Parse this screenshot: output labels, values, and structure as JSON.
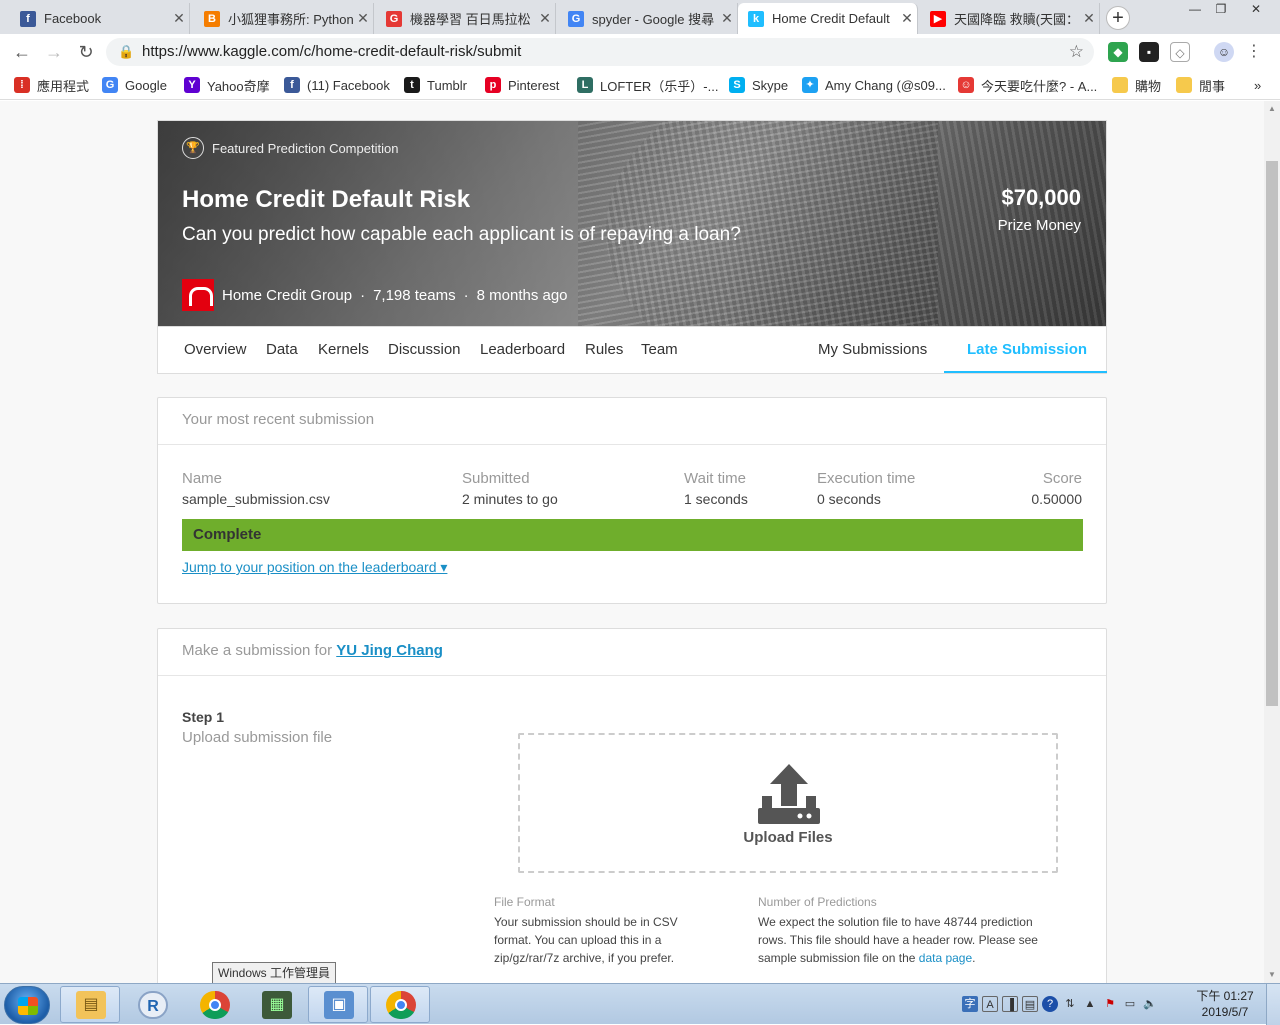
{
  "browser": {
    "tabs": [
      {
        "title": "Facebook",
        "icon": "facebook-icon",
        "color": "#3b5998",
        "glyph": "f"
      },
      {
        "title": "小狐狸事務所: Python",
        "icon": "blogger-icon",
        "color": "#f57d00",
        "glyph": "B"
      },
      {
        "title": "機器學習 百日馬拉松",
        "icon": "cupoy-icon",
        "color": "#e53935",
        "glyph": "G"
      },
      {
        "title": "spyder - Google 搜尋",
        "icon": "google-icon",
        "color": "#4285f4",
        "glyph": "G"
      },
      {
        "title": "Home Credit Default",
        "icon": "kaggle-icon",
        "color": "#20beff",
        "glyph": "k"
      },
      {
        "title": "天國降臨 救贖(天國：",
        "icon": "youtube-icon",
        "color": "#ff0000",
        "glyph": "▶"
      }
    ],
    "active_tab_index": 4,
    "url": "https://www.kaggle.com/c/home-credit-default-risk/submit",
    "bookmarks": [
      {
        "label": "應用程式",
        "icon": "apps-grid-icon",
        "color": "#d93025",
        "glyph": "⁞"
      },
      {
        "label": "Google",
        "icon": "google-icon",
        "color": "#4285f4",
        "glyph": "G"
      },
      {
        "label": "Yahoo奇摩",
        "icon": "yahoo-icon",
        "color": "#5f01d1",
        "glyph": "Y"
      },
      {
        "label": "(11) Facebook",
        "icon": "facebook-icon",
        "color": "#3b5998",
        "glyph": "f"
      },
      {
        "label": "Tumblr",
        "icon": "tumblr-icon",
        "color": "#1a1a1a",
        "glyph": "t"
      },
      {
        "label": "Pinterest",
        "icon": "pinterest-icon",
        "color": "#e60023",
        "glyph": "p"
      },
      {
        "label": "LOFTER（乐乎）-...",
        "icon": "lofter-icon",
        "color": "#2f6e63",
        "glyph": "L"
      },
      {
        "label": "Skype",
        "icon": "skype-icon",
        "color": "#00aff0",
        "glyph": "S"
      },
      {
        "label": "Amy Chang (@s09...",
        "icon": "twitter-icon",
        "color": "#1da1f2",
        "glyph": "✦"
      },
      {
        "label": "今天要吃什麼? - A...",
        "icon": "site-icon",
        "color": "#e53935",
        "glyph": "☺"
      },
      {
        "label": "購物",
        "icon": "folder-icon",
        "color": "#f6c94c",
        "glyph": ""
      },
      {
        "label": "閒事",
        "icon": "folder-icon",
        "color": "#f6c94c",
        "glyph": ""
      }
    ]
  },
  "competition": {
    "badge": "Featured Prediction Competition",
    "title": "Home Credit Default Risk",
    "subtitle": "Can you predict how capable each applicant is of repaying a loan?",
    "prize": "$70,000",
    "prize_label": "Prize Money",
    "host": "Home Credit Group",
    "teams": "7,198 teams",
    "age": "8 months ago"
  },
  "nav": {
    "items": [
      "Overview",
      "Data",
      "Kernels",
      "Discussion",
      "Leaderboard",
      "Rules",
      "Team"
    ],
    "my_submissions": "My Submissions",
    "late_submission": "Late Submission"
  },
  "recent": {
    "header": "Your most recent submission",
    "columns": {
      "name": "Name",
      "submitted": "Submitted",
      "wait": "Wait time",
      "exec": "Execution time",
      "score": "Score"
    },
    "values": {
      "name": "sample_submission.csv",
      "submitted": "2 minutes to go",
      "wait": "1 seconds",
      "exec": "0 seconds",
      "score": "0.50000"
    },
    "status": "Complete",
    "status_color": "#6fae2c",
    "jump_link": "Jump to your position on the leaderboard ▾"
  },
  "submit": {
    "header_prefix": "Make a submission for",
    "user": "YU Jing Chang",
    "step": "Step 1",
    "step_sub": "Upload submission file",
    "upload_label": "Upload Files",
    "file_format_title": "File Format",
    "file_format_text": "Your submission should be in CSV format. You can upload this in a zip/gz/rar/7z archive, if you prefer.",
    "num_pred_title": "Number of Predictions",
    "num_pred_text": "We expect the solution file to have 48744 prediction rows. This file should have a header row. Please see sample submission file on the",
    "num_pred_link": "data page",
    "num_pred_end": "."
  },
  "os": {
    "tooltip": "Windows 工作管理員",
    "clock_time": "下午 01:27",
    "clock_date": "2019/5/7"
  }
}
